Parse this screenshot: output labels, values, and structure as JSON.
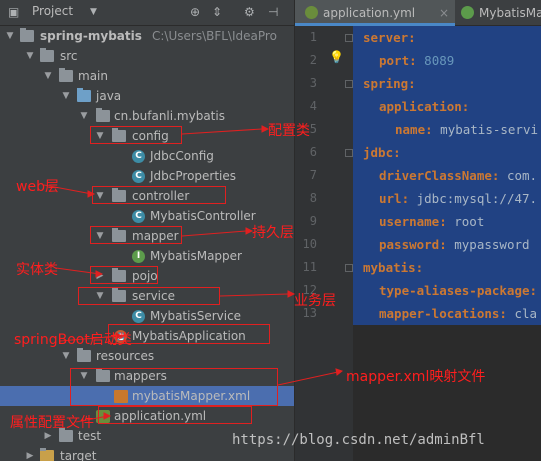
{
  "project_panel": {
    "title": "Project",
    "dropdown_icon": "chevron-down-icon",
    "toolbar_icons": [
      "globe-icon",
      "collapse-icon",
      "gear-icon",
      "hide-icon"
    ]
  },
  "tree": {
    "root": "spring-mybatis",
    "root_path": "C:\\Users\\BFL\\IdeaPro",
    "src": "src",
    "main": "main",
    "java": "java",
    "package": "cn.bufanli.mybatis",
    "config": "config",
    "jdbc_config": "JdbcConfig",
    "jdbc_properties": "JdbcProperties",
    "controller": "controller",
    "mybatis_controller": "MybatisController",
    "mapper": "mapper",
    "mybatis_mapper": "MybatisMapper",
    "pojo": "pojo",
    "service": "service",
    "mybatis_service": "MybatisService",
    "mybatis_application": "MybatisApplication",
    "resources": "resources",
    "mappers": "mappers",
    "mybatis_mapper_xml": "mybatisMapper.xml",
    "application_yml": "application.yml",
    "test": "test",
    "target": "target"
  },
  "editor": {
    "tabs": [
      {
        "label": "application.yml",
        "active": true
      },
      {
        "label": "MybatisMap",
        "active": false
      }
    ],
    "line_numbers": [
      "1",
      "2",
      "3",
      "4",
      "5",
      "6",
      "7",
      "8",
      "9",
      "10",
      "11",
      "12",
      "13"
    ],
    "lines": [
      {
        "key": "server:",
        "value": ""
      },
      {
        "key": "port:",
        "value": " 8089"
      },
      {
        "key": "spring:",
        "value": ""
      },
      {
        "key": "application:",
        "value": ""
      },
      {
        "key": "name:",
        "value": " mybatis-servi"
      },
      {
        "key": "jdbc:",
        "value": ""
      },
      {
        "key": "driverClassName:",
        "value": " com."
      },
      {
        "key": "url:",
        "value": " jdbc:mysql://47."
      },
      {
        "key": "username:",
        "value": " root"
      },
      {
        "key": "password:",
        "value": " mypassword"
      },
      {
        "key": "mybatis:",
        "value": ""
      },
      {
        "key": "type-aliases-package:",
        "value": ""
      },
      {
        "key": "mapper-locations:",
        "value": " cla"
      }
    ]
  },
  "annotations": {
    "config": "配置类",
    "web": "web层",
    "mapper": "持久层",
    "pojo": "实体类",
    "service": "业务层",
    "springboot": "springBoot启动类",
    "mapper_xml": "mapper.xml映射文件",
    "properties": "属性配置文件"
  },
  "watermark": "https://blog.csdn.net/adminBfl",
  "colors": {
    "annotation_red": "#ff1e1e",
    "selection_blue": "#4b6eaf",
    "editor_bg": "#2b2b2b",
    "keyword_orange": "#cc7832"
  }
}
